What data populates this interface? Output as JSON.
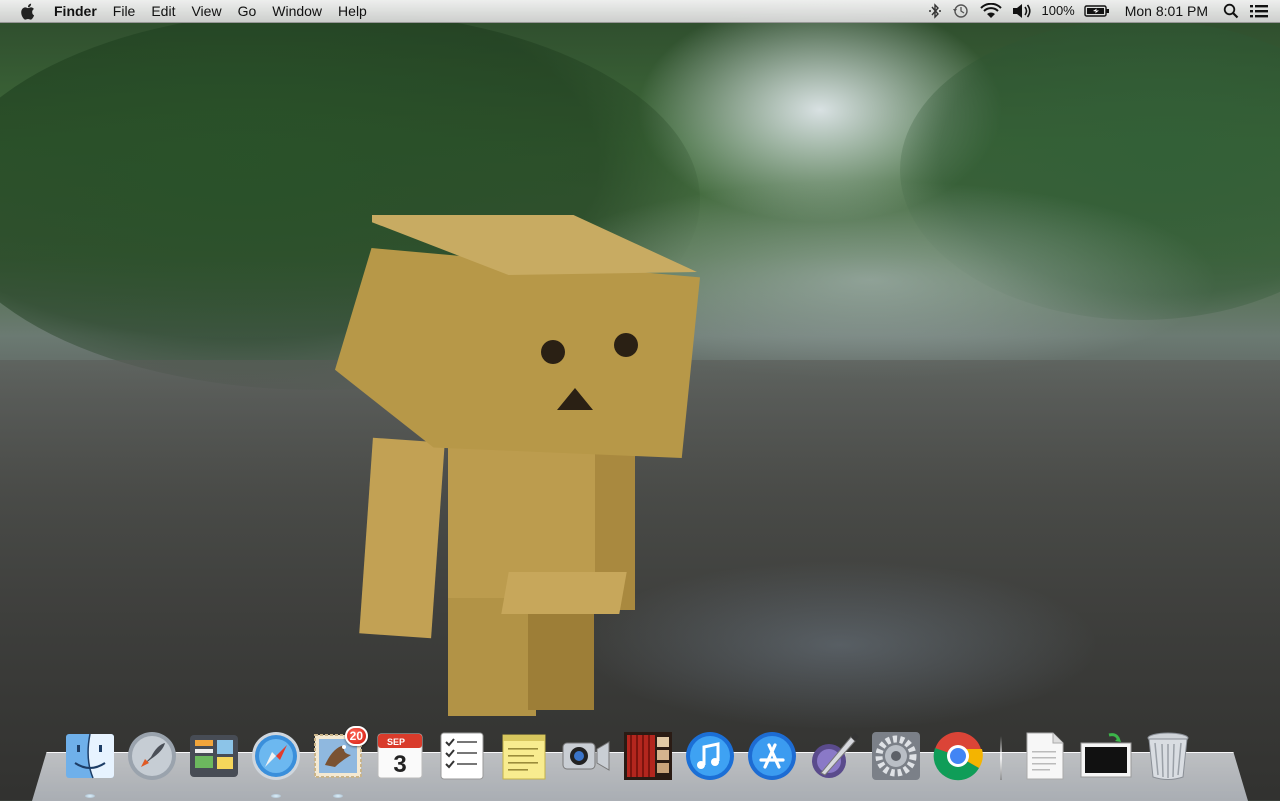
{
  "menubar": {
    "app_name": "Finder",
    "menus": [
      "File",
      "Edit",
      "View",
      "Go",
      "Window",
      "Help"
    ],
    "battery_text": "100%",
    "clock": "Mon 8:01 PM",
    "icons": [
      "apple-logo-icon",
      "bluetooth-icon",
      "time-machine-icon",
      "wifi-icon",
      "volume-icon",
      "battery-icon",
      "spotlight-search-icon",
      "notification-center-icon"
    ]
  },
  "dock": {
    "items": [
      {
        "name": "Finder",
        "icon": "finder-icon",
        "running": true
      },
      {
        "name": "Launchpad",
        "icon": "launchpad-icon",
        "running": false
      },
      {
        "name": "Dashboard",
        "icon": "dashboard-icon",
        "running": false
      },
      {
        "name": "Safari",
        "icon": "safari-icon",
        "running": true
      },
      {
        "name": "Mail",
        "icon": "mail-icon",
        "running": true,
        "badge": "20"
      },
      {
        "name": "Calendar",
        "icon": "calendar-icon",
        "running": false,
        "month": "SEP",
        "day": "3"
      },
      {
        "name": "Reminders",
        "icon": "reminders-icon",
        "running": false
      },
      {
        "name": "Notes",
        "icon": "notes-icon",
        "running": false
      },
      {
        "name": "FaceTime",
        "icon": "facetime-icon",
        "running": false
      },
      {
        "name": "Photo Booth",
        "icon": "photo-booth-icon",
        "running": false
      },
      {
        "name": "iTunes",
        "icon": "itunes-icon",
        "running": false
      },
      {
        "name": "App Store",
        "icon": "app-store-icon",
        "running": false
      },
      {
        "name": "Script Editor",
        "icon": "script-editor-icon",
        "running": false
      },
      {
        "name": "System Preferences",
        "icon": "system-preferences-icon",
        "running": false
      },
      {
        "name": "Google Chrome",
        "icon": "chrome-icon",
        "running": false
      }
    ],
    "right_items": [
      {
        "name": "Documents",
        "icon": "document-stack-icon"
      },
      {
        "name": "Downloads",
        "icon": "screen-sharing-icon"
      },
      {
        "name": "Trash",
        "icon": "trash-icon"
      }
    ]
  },
  "colors": {
    "menubar": "#e8e8e8",
    "badge": "#d2140a",
    "wallpaper_green": "#3f6b3a",
    "cardboard": "#b99a52"
  }
}
